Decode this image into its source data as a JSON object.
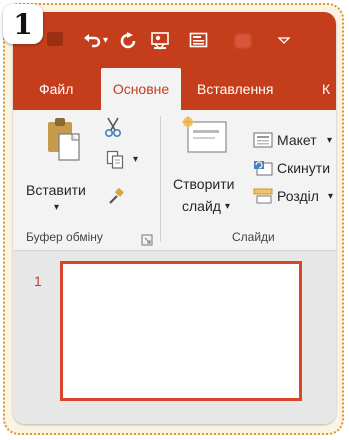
{
  "step_badge": "1",
  "quick_access": {
    "undo_icon": "undo-arrow-icon",
    "undo_dropdown": "▾",
    "redo_icon": "redo-icon",
    "presenter_icon": "slideshow-from-start-icon",
    "layout_icon": "layout-icon",
    "customize_icon": "customize-toolbar-icon"
  },
  "tabs": [
    {
      "label": "Файл"
    },
    {
      "label": "Основне"
    },
    {
      "label": "Вставлення"
    },
    {
      "label": "К"
    }
  ],
  "ribbon": {
    "clipboard": {
      "paste_label": "Вставити",
      "paste_arrow": "▾",
      "copy_arrow": "▾",
      "group_label": "Буфер обміну"
    },
    "slides": {
      "new_slide_line1": "Створити",
      "new_slide_line2": "слайд",
      "new_slide_arrow": "▾",
      "layout_label": "Макет",
      "layout_arrow": "▾",
      "reset_label": "Скинути",
      "section_label": "Розділ",
      "section_arrow": "▾",
      "group_label": "Слайди"
    }
  },
  "slides_pane": {
    "slide_number": "1"
  },
  "colors": {
    "accent": "#c43e1c",
    "thumb_border": "#d9472b",
    "frame_dots": "#d89a2a"
  }
}
